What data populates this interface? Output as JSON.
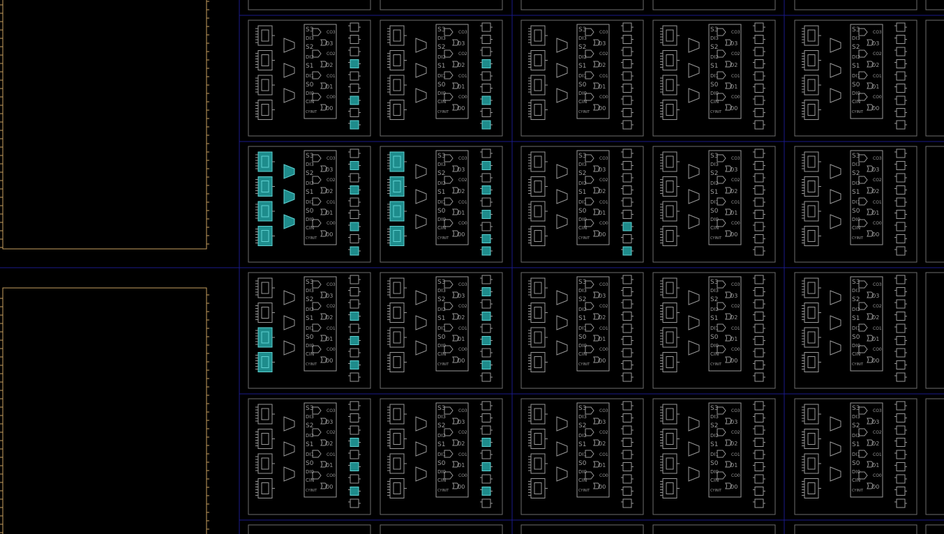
{
  "view": "FPGA device view",
  "colors": {
    "background": "#000000",
    "grid_line": "#1a1a8a",
    "slice_border": "#6e6e6e",
    "bel_outline": "#9a9a9a",
    "bram_border": "#c8a060",
    "used_fill": "#1e8c8c",
    "used_stroke": "#5fd2d2"
  },
  "carry_labels": {
    "left": [
      "S3",
      "DI3",
      "S2",
      "DI2",
      "S1",
      "DI1",
      "S0",
      "DI0",
      "CIN",
      "CYINIT"
    ],
    "left_display": [
      "S3",
      "DI3",
      "S2",
      "DI2",
      "S1",
      "DI1",
      "S0",
      "DI0",
      "CIN",
      "CYINIT"
    ],
    "right": [
      "CO3",
      "O3",
      "CO2",
      "O2",
      "CO1",
      "O1",
      "CO0",
      "O0"
    ]
  },
  "tiles": [
    {
      "id": "r1c1",
      "used_lut": [],
      "used_mux": [],
      "used_ff": [
        3,
        6,
        8
      ]
    },
    {
      "id": "r1c2",
      "used_lut": [],
      "used_mux": [],
      "used_ff": [
        3,
        6,
        8
      ]
    },
    {
      "id": "r1c3",
      "used_lut": [],
      "used_mux": [],
      "used_ff": []
    },
    {
      "id": "r1c4",
      "used_lut": [],
      "used_mux": [],
      "used_ff": []
    },
    {
      "id": "r1c5",
      "used_lut": [],
      "used_mux": [],
      "used_ff": []
    },
    {
      "id": "r2c1",
      "used_lut": [
        0,
        1,
        2,
        3
      ],
      "used_mux": [
        0,
        1,
        2
      ],
      "used_ff": [
        1,
        3,
        6,
        8
      ]
    },
    {
      "id": "r2c2",
      "used_lut": [
        0,
        1,
        2,
        3
      ],
      "used_mux": [],
      "used_ff": [
        1,
        3,
        5,
        7,
        8
      ]
    },
    {
      "id": "r2c3",
      "used_lut": [],
      "used_mux": [],
      "used_ff": [
        6,
        8
      ]
    },
    {
      "id": "r2c4",
      "used_lut": [],
      "used_mux": [],
      "used_ff": []
    },
    {
      "id": "r2c5",
      "used_lut": [],
      "used_mux": [],
      "used_ff": []
    },
    {
      "id": "r3c1",
      "used_lut": [
        2,
        3
      ],
      "used_mux": [],
      "used_ff": [
        3,
        5,
        7
      ]
    },
    {
      "id": "r3c2",
      "used_lut": [],
      "used_mux": [],
      "used_ff": [
        1,
        3,
        5,
        7
      ]
    },
    {
      "id": "r3c3",
      "used_lut": [],
      "used_mux": [],
      "used_ff": []
    },
    {
      "id": "r3c4",
      "used_lut": [],
      "used_mux": [],
      "used_ff": []
    },
    {
      "id": "r3c5",
      "used_lut": [],
      "used_mux": [],
      "used_ff": []
    },
    {
      "id": "r4c1",
      "used_lut": [],
      "used_mux": [],
      "used_ff": [
        3,
        5,
        7
      ]
    },
    {
      "id": "r4c2",
      "used_lut": [],
      "used_mux": [],
      "used_ff": [
        3,
        5,
        7
      ]
    },
    {
      "id": "r4c3",
      "used_lut": [],
      "used_mux": [],
      "used_ff": []
    },
    {
      "id": "r4c4",
      "used_lut": [],
      "used_mux": [],
      "used_ff": []
    },
    {
      "id": "r4c5",
      "used_lut": [],
      "used_mux": [],
      "used_ff": []
    }
  ]
}
